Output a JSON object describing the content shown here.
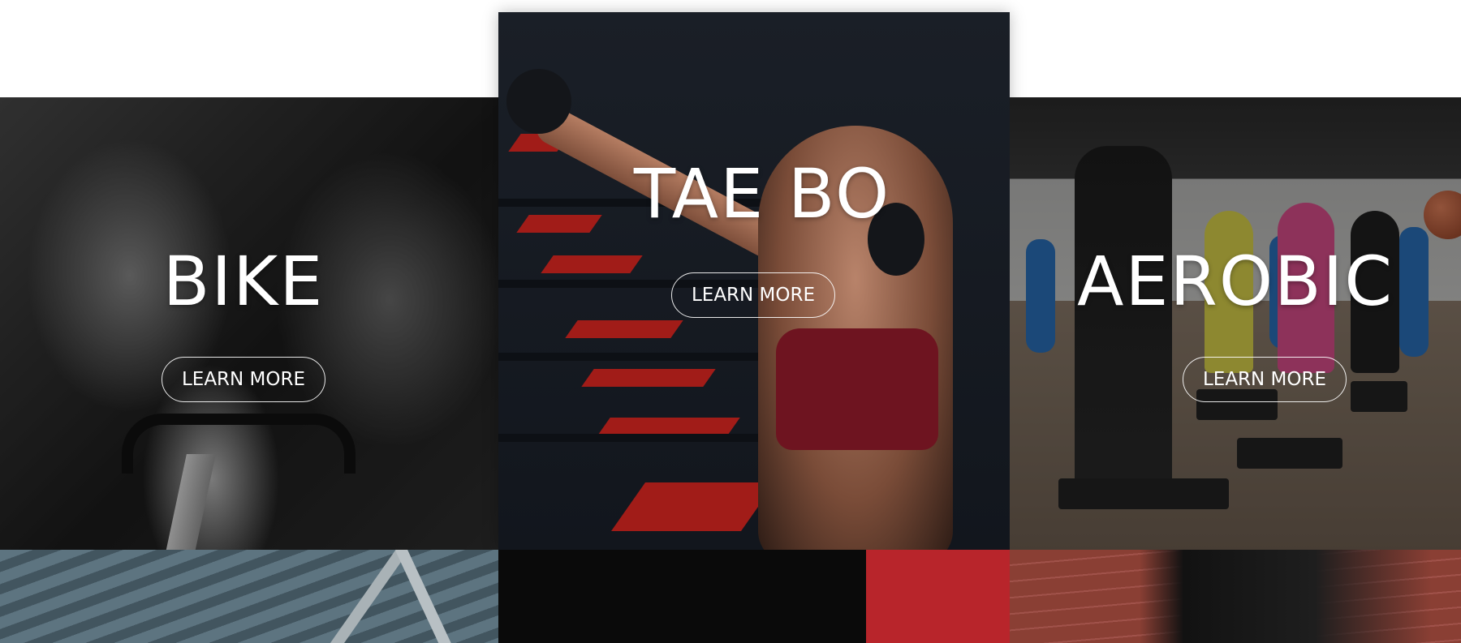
{
  "classes": [
    {
      "title": "BIKE",
      "button_label": "LEARN MORE"
    },
    {
      "title": "TAE BO",
      "button_label": "LEARN MORE"
    },
    {
      "title": "AEROBIC",
      "button_label": "LEARN MORE"
    }
  ],
  "colors": {
    "button_border": "#ffffff",
    "text": "#ffffff",
    "accent_red": "#b8252b"
  }
}
